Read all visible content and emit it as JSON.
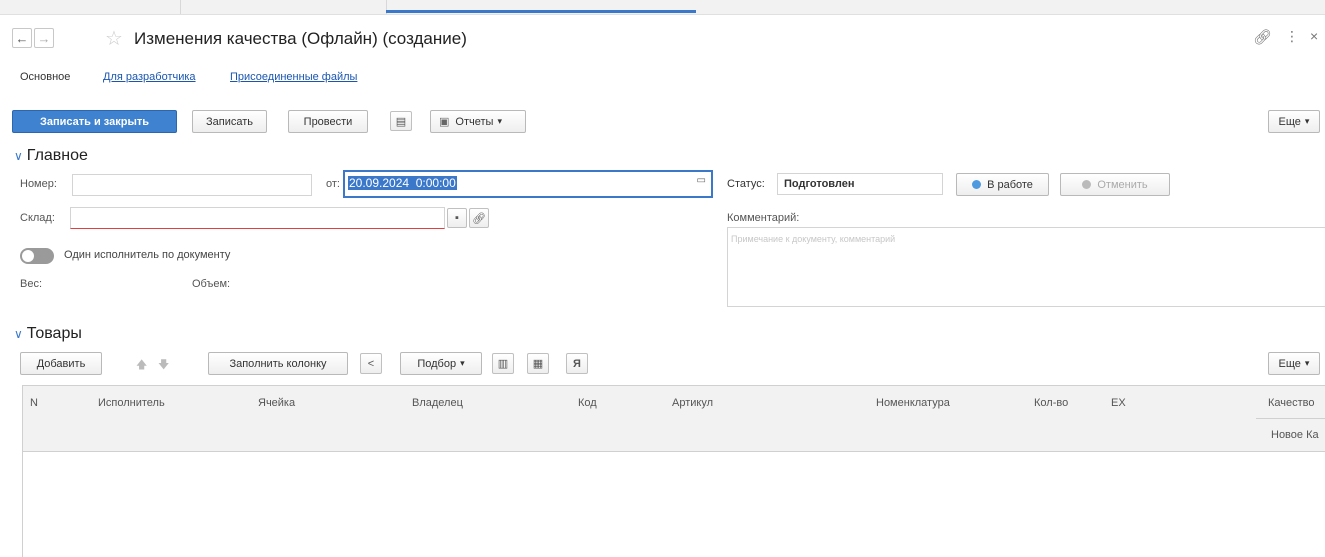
{
  "window": {
    "title": "Изменения качества (Офлайн) (создание)",
    "nav_back": "←",
    "nav_forward": "→"
  },
  "tabs": [
    "Основное",
    "Для разработчика",
    "Присоединенные файлы"
  ],
  "toolbar": {
    "write_close": "Записать и закрыть",
    "write": "Записать",
    "post": "Провести",
    "reports": "Отчеты",
    "more": "Еще"
  },
  "main_section": {
    "title": "Главное",
    "number_label": "Номер:",
    "number_value": "",
    "from_label": "от:",
    "date_value": "20.09.2024  0:00:00",
    "warehouse_label": "Склад:",
    "warehouse_value": "",
    "status_label": "Статус:",
    "status_value": "Подготовлен",
    "in_work_button": "В работе",
    "cancel_button": "Отменить",
    "comment_label": "Комментарий:",
    "comment_placeholder": "Примечание к документу, комментарий",
    "toggle_label": "Один исполнитель по документу",
    "weight_label": "Вес:",
    "volume_label": "Объем:"
  },
  "goods_section": {
    "title": "Товары",
    "add_button": "Добавить",
    "fill_column_button": "Заполнить колонку",
    "selection_button": "Подбор",
    "more": "Еще",
    "columns": [
      "N",
      "Исполнитель",
      "Ячейка",
      "Владелец",
      "Код",
      "Артикул",
      "Номенклатура",
      "Кол-во",
      "EX",
      "Качество"
    ],
    "subcolumn": "Новое Ка"
  },
  "icons": {
    "star": "star-icon",
    "link": "link-icon",
    "menu": "more-vert-icon",
    "close": "close-icon",
    "calendar": "calendar-icon"
  },
  "colors": {
    "accent": "#3e82d0",
    "link": "#1a56b0",
    "error_underline": "#e04040"
  }
}
